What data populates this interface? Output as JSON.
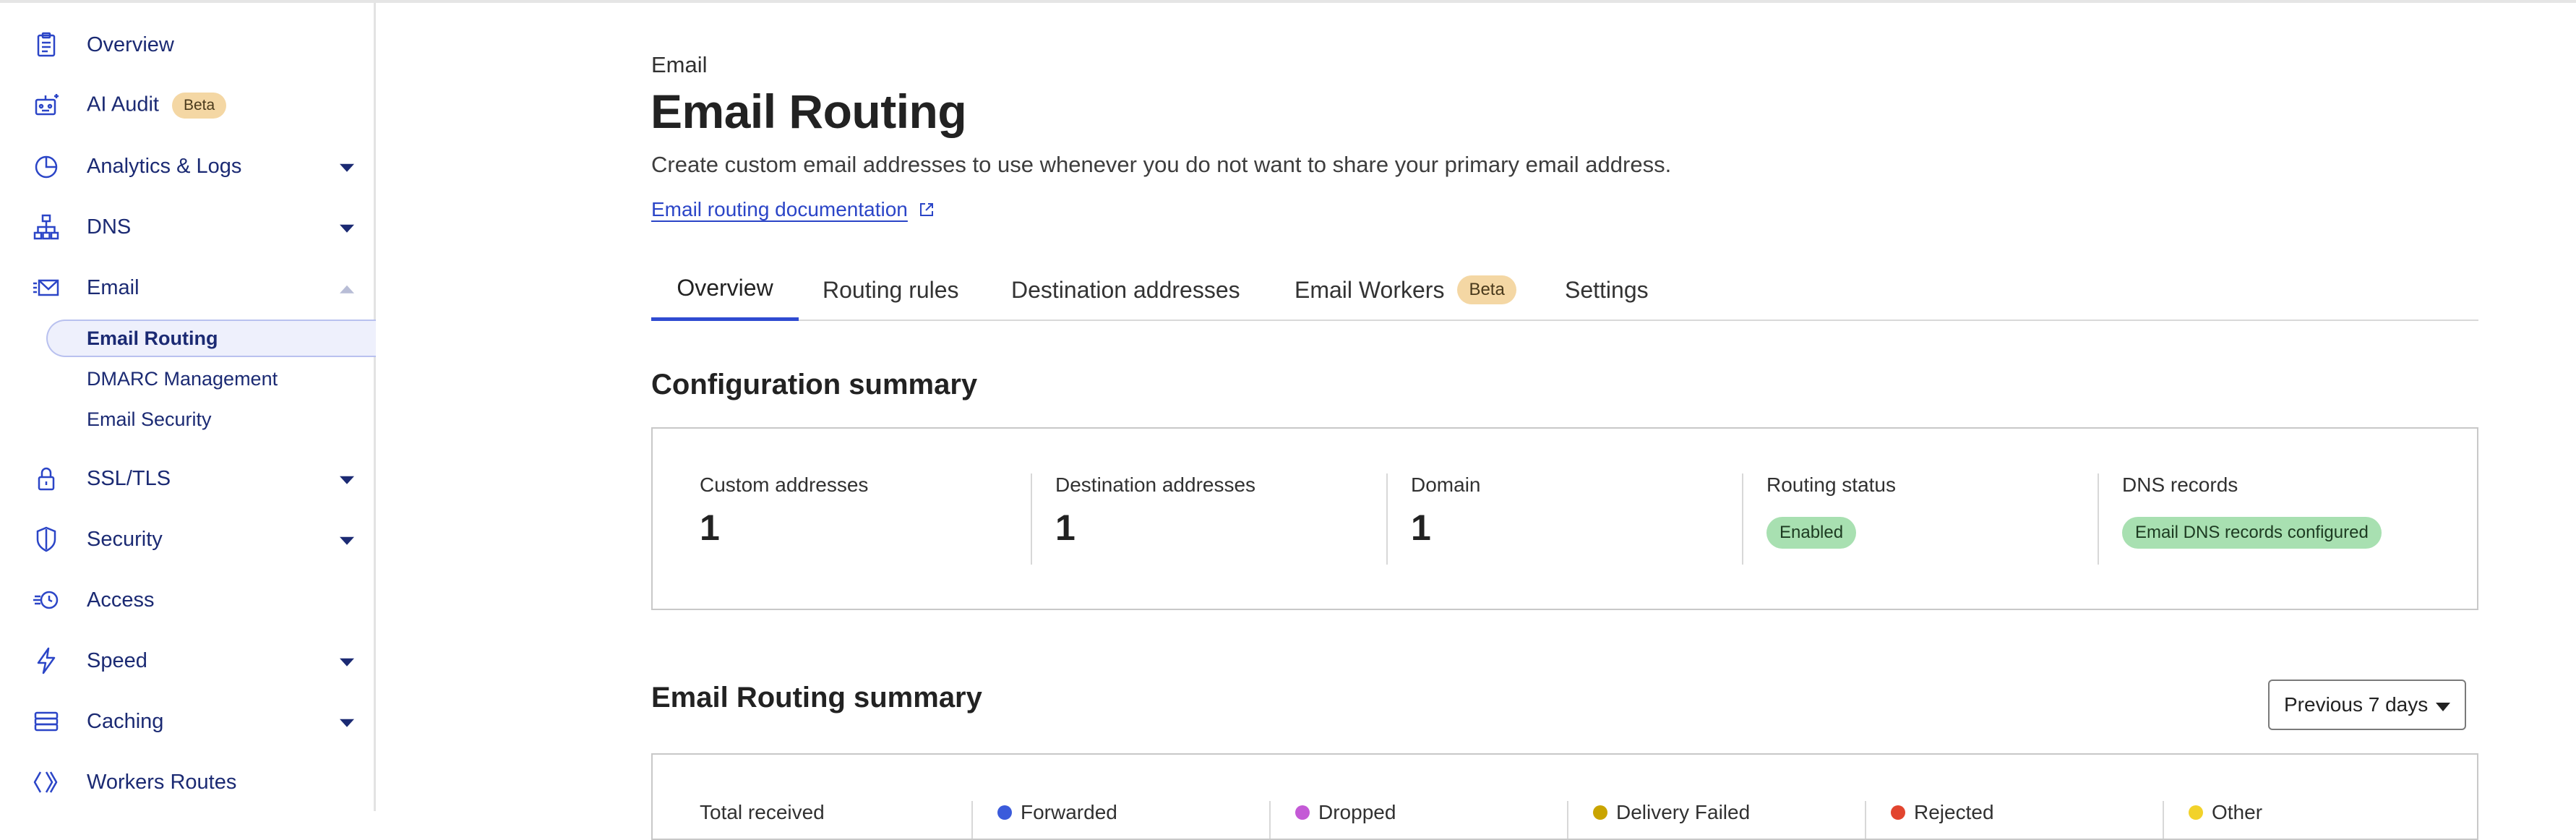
{
  "sidebar": {
    "items": [
      {
        "label": "Overview",
        "icon": "clipboard-icon"
      },
      {
        "label": "AI Audit",
        "icon": "robot-icon",
        "badge": "Beta"
      },
      {
        "label": "Analytics & Logs",
        "icon": "pie-chart-icon"
      },
      {
        "label": "DNS",
        "icon": "network-icon"
      },
      {
        "label": "Email",
        "icon": "email-icon"
      },
      {
        "label": "SSL/TLS",
        "icon": "lock-icon"
      },
      {
        "label": "Security",
        "icon": "shield-icon"
      },
      {
        "label": "Access",
        "icon": "access-icon"
      },
      {
        "label": "Speed",
        "icon": "lightning-icon"
      },
      {
        "label": "Caching",
        "icon": "server-stack-icon"
      },
      {
        "label": "Workers Routes",
        "icon": "workers-icon"
      }
    ],
    "email_sub": [
      {
        "label": "Email Routing",
        "active": true
      },
      {
        "label": "DMARC Management"
      },
      {
        "label": "Email Security"
      }
    ]
  },
  "header": {
    "eyebrow": "Email",
    "title": "Email Routing",
    "description": "Create custom email addresses to use whenever you do not want to share your primary email address.",
    "doc_link": "Email routing documentation"
  },
  "tabs": [
    {
      "label": "Overview",
      "active": true
    },
    {
      "label": "Routing rules"
    },
    {
      "label": "Destination addresses"
    },
    {
      "label": "Email Workers",
      "badge": "Beta"
    },
    {
      "label": "Settings"
    }
  ],
  "config_summary": {
    "title": "Configuration summary",
    "stats": [
      {
        "label": "Custom addresses",
        "value": "1"
      },
      {
        "label": "Destination addresses",
        "value": "1"
      },
      {
        "label": "Domain",
        "value": "1"
      },
      {
        "label": "Routing status",
        "pill": "Enabled"
      },
      {
        "label": "DNS records",
        "pill": "Email DNS records configured"
      }
    ]
  },
  "routing_summary": {
    "title": "Email Routing summary",
    "period": "Previous 7 days",
    "legend": [
      {
        "label": "Total received",
        "color": ""
      },
      {
        "label": "Forwarded",
        "color": "#3b5bdb"
      },
      {
        "label": "Dropped",
        "color": "#c45ad6"
      },
      {
        "label": "Delivery Failed",
        "color": "#c9a400"
      },
      {
        "label": "Rejected",
        "color": "#e2452f"
      },
      {
        "label": "Other",
        "color": "#f2d22a"
      }
    ]
  },
  "colors": {
    "accent": "#2f4bd1",
    "nav_text": "#1b2a73",
    "beta_badge": "#f4d7a4",
    "success_pill": "#a8e0b1"
  }
}
